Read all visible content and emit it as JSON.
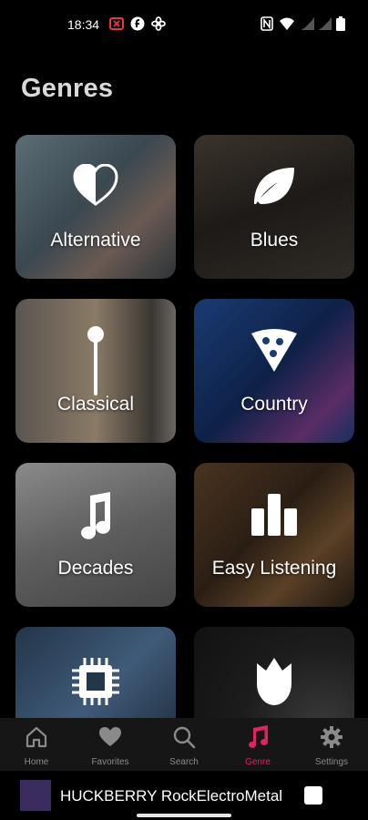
{
  "status_bar": {
    "time": "18:34",
    "left_icons": [
      "alert-icon",
      "f-app-icon",
      "fan-icon"
    ],
    "right_icons": [
      "nfc-icon",
      "wifi-icon",
      "signal-icon",
      "signal-icon",
      "battery-icon"
    ]
  },
  "page": {
    "title": "Genres"
  },
  "genres": [
    {
      "label": "Alternative",
      "icon": "heart-half-icon",
      "bg": "#3c4a52"
    },
    {
      "label": "Blues",
      "icon": "leaf-icon",
      "bg": "#2b2622"
    },
    {
      "label": "Classical",
      "icon": "pin-icon",
      "bg": "#6c6762"
    },
    {
      "label": "Country",
      "icon": "pizza-icon",
      "bg": "#173565"
    },
    {
      "label": "Decades",
      "icon": "music-note-icon",
      "bg": "#6e6e6e"
    },
    {
      "label": "Easy Listening",
      "icon": "bar-chart-icon",
      "bg": "#3a2a1c"
    },
    {
      "label": "",
      "icon": "chip-icon",
      "bg": "#2a3d52"
    },
    {
      "label": "",
      "icon": "rose-icon",
      "bg": "#262626"
    }
  ],
  "bottom_nav": {
    "items": [
      {
        "label": "Home",
        "icon": "home-icon",
        "active": false
      },
      {
        "label": "Favorites",
        "icon": "heart-icon",
        "active": false
      },
      {
        "label": "Search",
        "icon": "search-icon",
        "active": false
      },
      {
        "label": "Genre",
        "icon": "music-note-icon",
        "active": true
      },
      {
        "label": "Settings",
        "icon": "gear-icon",
        "active": false
      }
    ],
    "active_color": "#e0245e",
    "inactive_color": "#8a8a8a"
  },
  "player": {
    "track": "HUCKBERRY RockElectroMetal",
    "control_icon": "stop-icon"
  }
}
